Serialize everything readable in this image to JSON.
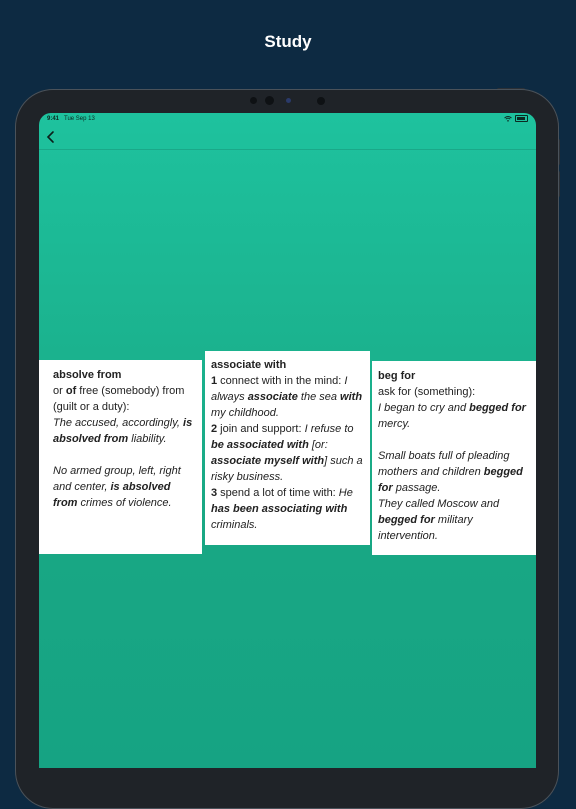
{
  "promo": {
    "title": "Study"
  },
  "status_bar": {
    "time": "9:41",
    "date": "Tue Sep 13"
  },
  "nav": {
    "back_icon": "chevron-left-icon"
  },
  "colors": {
    "background": "#0d2a42",
    "screen_top": "#1ec29e",
    "screen_bottom": "#16a383",
    "card": "#ffffff"
  },
  "cards": [
    {
      "headword": "absolve from",
      "lines": [
        {
          "t": "or ",
          "s": "n"
        },
        {
          "t": "of",
          "s": "b"
        },
        {
          "t": " free (somebody) from (guilt or a duty):",
          "s": "n"
        }
      ],
      "ex1": [
        {
          "t": "The accused, accordingly, ",
          "s": "i"
        },
        {
          "t": "is absolved from",
          "s": "bi"
        },
        {
          "t": " liability.",
          "s": "i"
        }
      ],
      "ex2": [
        {
          "t": "No armed group, left, right and center, ",
          "s": "i"
        },
        {
          "t": "is absolved from",
          "s": "bi"
        },
        {
          "t": " crimes of violence.",
          "s": "i"
        }
      ]
    },
    {
      "headword": "associate with",
      "s1": [
        {
          "t": "1",
          "s": "b"
        },
        {
          "t": " connect with in the mind: ",
          "s": "n"
        },
        {
          "t": "I always ",
          "s": "i"
        },
        {
          "t": "associate",
          "s": "bi"
        },
        {
          "t": " the sea ",
          "s": "i"
        },
        {
          "t": "with",
          "s": "bi"
        },
        {
          "t": " my childhood.",
          "s": "i"
        }
      ],
      "s2": [
        {
          "t": "2",
          "s": "b"
        },
        {
          "t": " join and support: ",
          "s": "n"
        },
        {
          "t": "I refuse to ",
          "s": "i"
        },
        {
          "t": "be associated with",
          "s": "bi"
        },
        {
          "t": " [or: ",
          "s": "i"
        },
        {
          "t": "associate myself with",
          "s": "bi"
        },
        {
          "t": "] such a risky business.",
          "s": "i"
        }
      ],
      "s3": [
        {
          "t": "3",
          "s": "b"
        },
        {
          "t": " spend a lot of time with: ",
          "s": "n"
        },
        {
          "t": "He ",
          "s": "i"
        },
        {
          "t": "has been associating with",
          "s": "bi"
        },
        {
          "t": " criminals.",
          "s": "i"
        }
      ]
    },
    {
      "headword": "beg for",
      "def": [
        {
          "t": "ask for (something):",
          "s": "n"
        }
      ],
      "ex1": [
        {
          "t": "I began to cry and ",
          "s": "i"
        },
        {
          "t": "begged for",
          "s": "bi"
        },
        {
          "t": " mercy.",
          "s": "i"
        }
      ],
      "ex2": [
        {
          "t": "Small boats full of pleading mothers and children ",
          "s": "i"
        },
        {
          "t": "begged for",
          "s": "bi"
        },
        {
          "t": " passage.",
          "s": "i"
        }
      ],
      "ex3": [
        {
          "t": "They called Moscow and ",
          "s": "i"
        },
        {
          "t": "begged for",
          "s": "bi"
        },
        {
          "t": " military intervention.",
          "s": "i"
        }
      ]
    }
  ]
}
